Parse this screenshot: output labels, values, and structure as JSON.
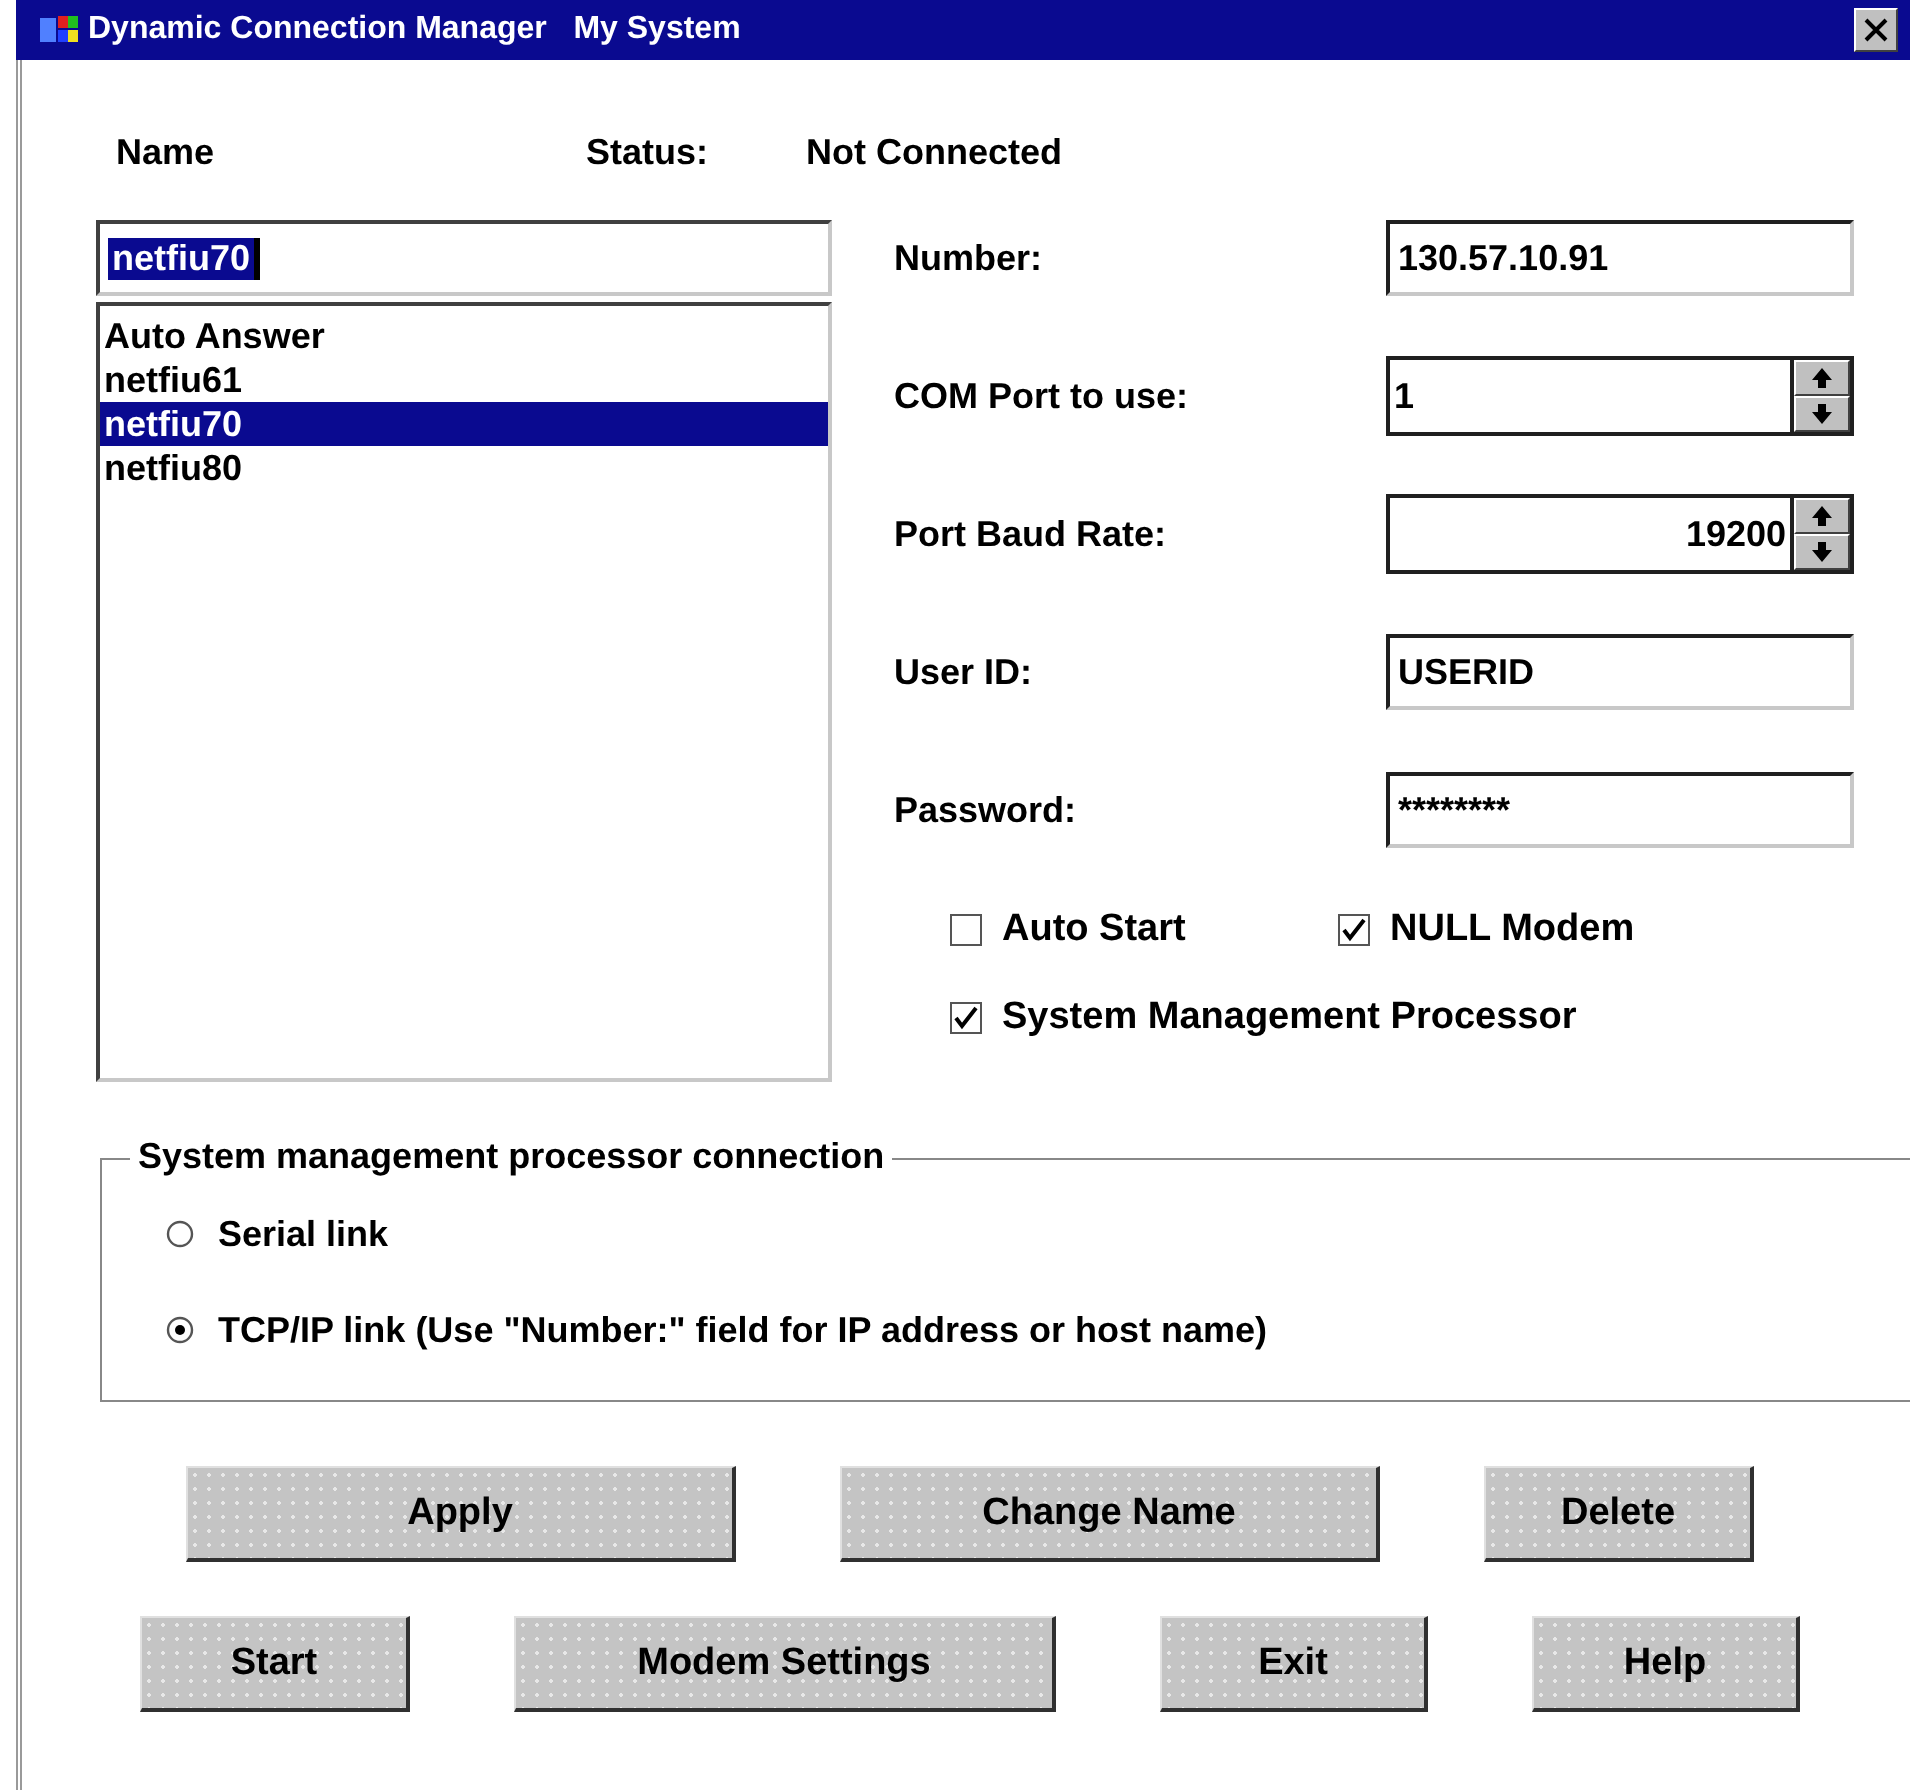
{
  "window": {
    "title": "Dynamic Connection Manager   My System"
  },
  "header": {
    "name_label": "Name",
    "status_label": "Status:",
    "status_value": "Not Connected"
  },
  "name_field": {
    "value": "netfiu70",
    "text_selected": true
  },
  "connections": [
    {
      "label": "Auto Answer",
      "selected": false
    },
    {
      "label": "netfiu61",
      "selected": false
    },
    {
      "label": "netfiu70",
      "selected": true
    },
    {
      "label": "netfiu80",
      "selected": false
    }
  ],
  "fields": [
    {
      "label": "Number:",
      "value": "130.57.10.91",
      "kind": "text"
    },
    {
      "label": "COM Port to use:",
      "value": "1",
      "kind": "spin"
    },
    {
      "label": "Port Baud Rate:",
      "value": "19200",
      "kind": "numspin"
    },
    {
      "label": "User ID:",
      "value": "USERID",
      "kind": "text"
    },
    {
      "label": "Password:",
      "value": "********",
      "kind": "text"
    }
  ],
  "options": [
    {
      "label": "Auto Start",
      "checked": false
    },
    {
      "label": "NULL Modem",
      "checked": true
    },
    {
      "label": "System Management Processor",
      "checked": true
    }
  ],
  "connection_group": {
    "title": "System management processor connection",
    "options": [
      {
        "label": "Serial link",
        "selected": false
      },
      {
        "label": "TCP/IP link (Use \"Number:\" field for IP address or host name)",
        "selected": true
      }
    ]
  },
  "button_rows": [
    {
      "buttons": [
        "Apply",
        "Change Name",
        "Delete"
      ]
    },
    {
      "buttons": [
        "Start",
        "Modem Settings",
        "Exit",
        "Help"
      ]
    }
  ]
}
